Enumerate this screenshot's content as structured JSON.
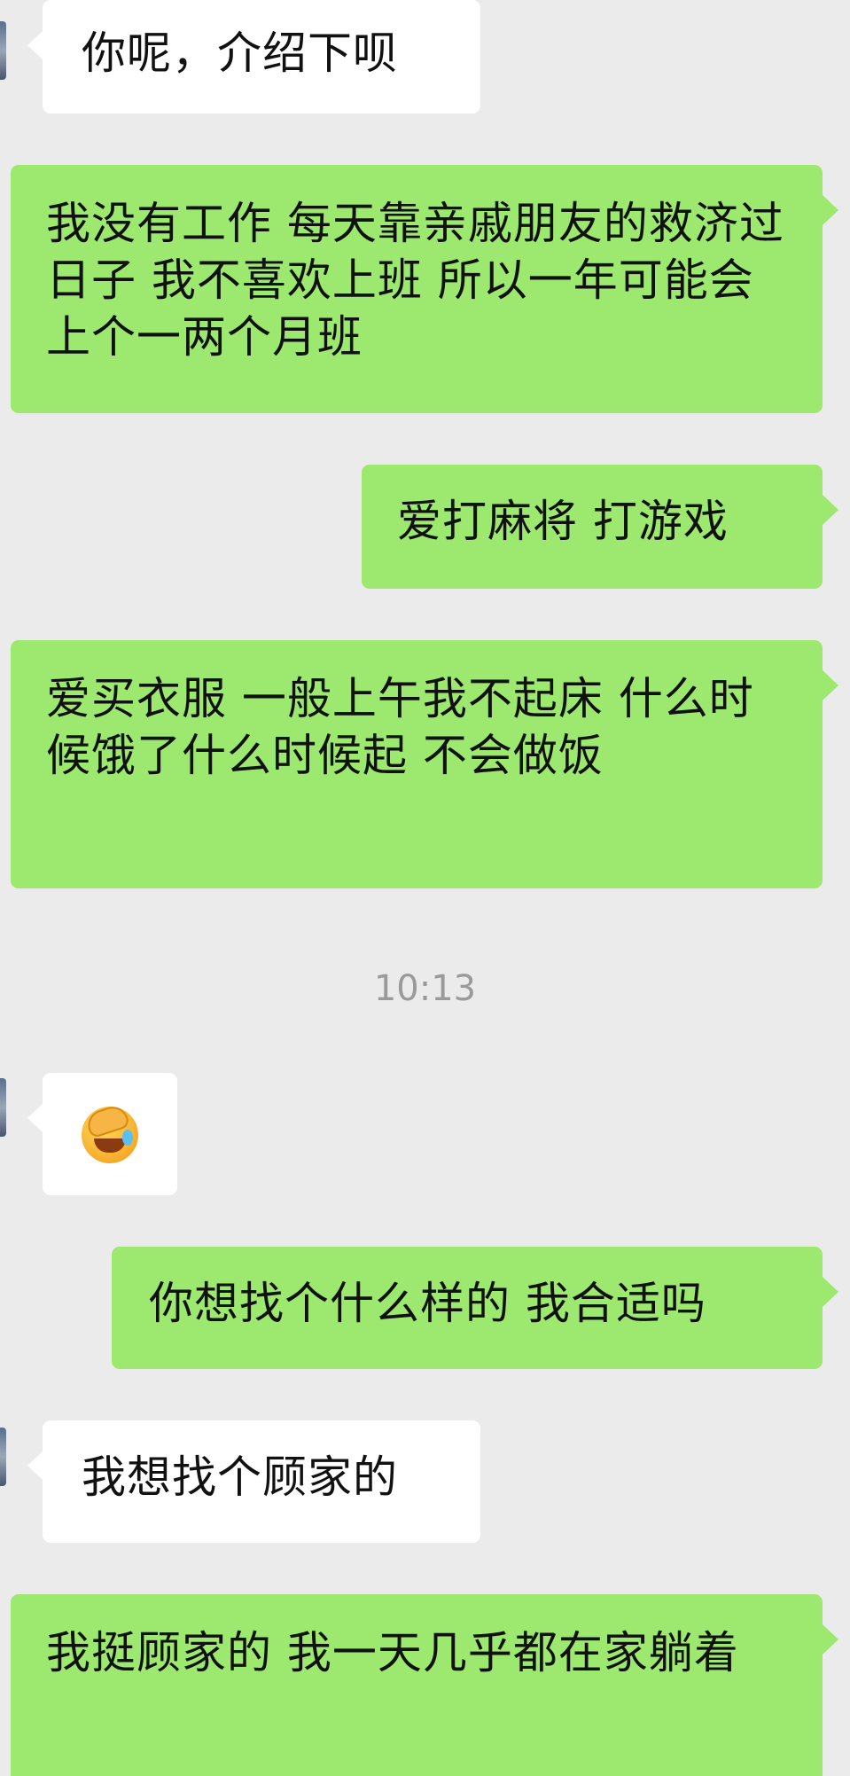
{
  "messages": [
    {
      "side": "in",
      "text": "你呢，介绍下呗"
    },
    {
      "side": "out",
      "text": "我没有工作 每天靠亲戚朋友的救济过日子 我不喜欢上班 所以一年可能会上个一两个月班"
    },
    {
      "side": "out",
      "text": "爱打麻将 打游戏"
    },
    {
      "side": "out",
      "text": "爱买衣服 一般上午我不起床 什么时候饿了什么时候起 不会做饭"
    },
    {
      "side": "in",
      "text": "",
      "emoji": "face-palm-laughing-emoji"
    },
    {
      "side": "out",
      "text": "你想找个什么样的 我合适吗"
    },
    {
      "side": "in",
      "text": "我想找个顾家的"
    },
    {
      "side": "out",
      "text": "我挺顾家的 我一天几乎都在家躺着"
    }
  ],
  "timestamp": "10:13",
  "colors": {
    "background": "#ebebeb",
    "incoming_bubble": "#ffffff",
    "outgoing_bubble": "#9de86f",
    "timestamp_text": "#9a9a9a"
  }
}
